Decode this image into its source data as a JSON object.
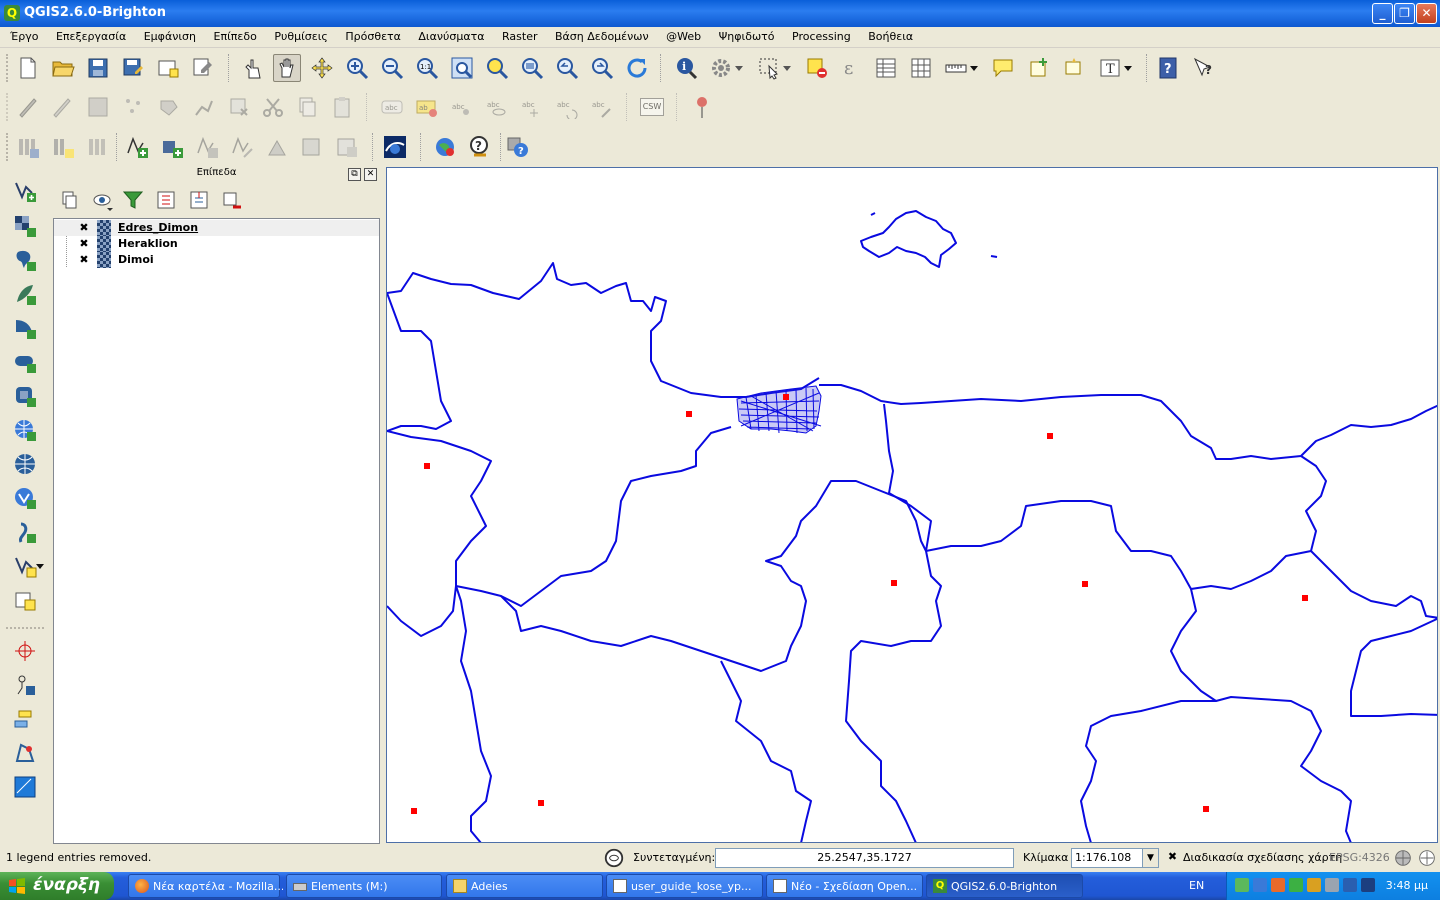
{
  "window": {
    "title": "QGIS2.6.0-Brighton"
  },
  "menu": [
    "Έργο",
    "Επεξεργασία",
    "Εμφάνιση",
    "Επίπεδο",
    "Ρυθμίσεις",
    "Πρόσθετα",
    "Διανύσματα",
    "Raster",
    "Βάση Δεδομένων",
    "@Web",
    "Ψηφιδωτό",
    "Processing",
    "Βοήθεια"
  ],
  "toolbar3": {
    "csw_label": "CSW"
  },
  "layers_panel": {
    "title": "Επίπεδα",
    "layers": [
      {
        "name": "Edres_Dimon",
        "checked": "✖",
        "selected": true
      },
      {
        "name": "Heraklion",
        "checked": "✖"
      },
      {
        "name": "Dimoi",
        "checked": "✖"
      }
    ]
  },
  "status": {
    "message": "1 legend entries removed.",
    "coord_label": "Συντεταγμένη:",
    "coord_value": "25.2547,35.1727",
    "scale_label": "Κλίμακα",
    "scale_value": "1:176.108",
    "render_label": "Διαδικασία σχεδίασης χάρτη",
    "render_checked": "✖",
    "crs": "EPSG:4326"
  },
  "taskbar": {
    "start_label": "έναρξη",
    "tasks": [
      {
        "label": "Νέα καρτέλα - Mozilla...",
        "icon": "firefox-icon"
      },
      {
        "label": "Elements (M:)",
        "icon": "drive-icon"
      },
      {
        "label": "Adeies",
        "icon": "folder-icon"
      },
      {
        "label": "user_guide_kose_yp...",
        "icon": "document-icon"
      },
      {
        "label": "Νέο - Σχεδίαση Open...",
        "icon": "document-icon"
      },
      {
        "label": "QGIS2.6.0-Brighton",
        "icon": "qgis-icon",
        "active": true
      }
    ],
    "language": "EN",
    "clock": "3:48 μμ"
  },
  "colors": {
    "boundary": "#0a0ae0",
    "point": "#ff0000",
    "title_bar": "#0a5fd9"
  }
}
